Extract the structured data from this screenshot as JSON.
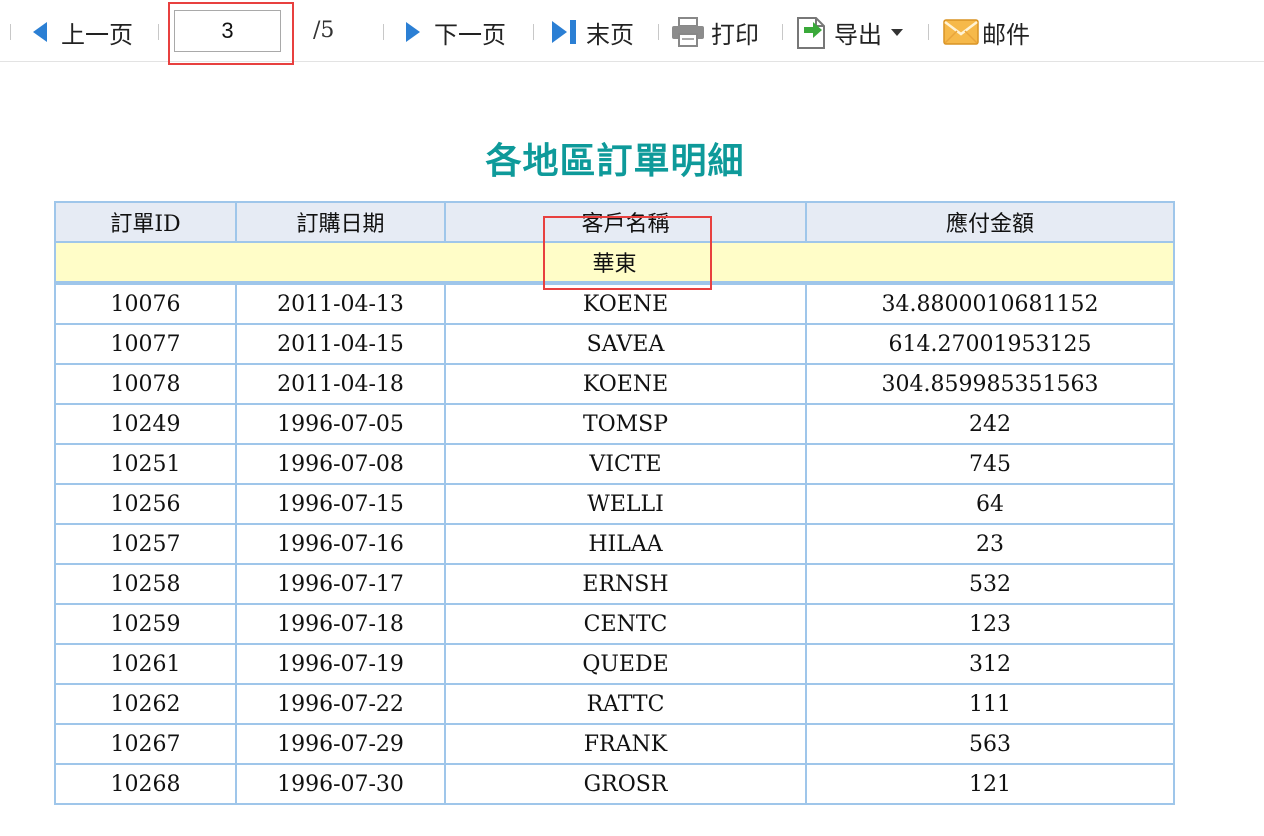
{
  "toolbar": {
    "prev_label": "上一页",
    "current_page": "3",
    "total_pages": "/5",
    "next_label": "下一页",
    "last_label": "末页",
    "print_label": "打印",
    "export_label": "导出",
    "mail_label": "邮件"
  },
  "report": {
    "title": "各地區訂單明細",
    "headers": {
      "order_id": "訂單ID",
      "order_date": "訂購日期",
      "customer": "客戶名稱",
      "amount": "應付金額"
    },
    "group": "華東",
    "rows": [
      {
        "id": "10076",
        "date": "2011-04-13",
        "customer": "KOENE",
        "amount": "34.8800010681152"
      },
      {
        "id": "10077",
        "date": "2011-04-15",
        "customer": "SAVEA",
        "amount": "614.27001953125"
      },
      {
        "id": "10078",
        "date": "2011-04-18",
        "customer": "KOENE",
        "amount": "304.859985351563"
      },
      {
        "id": "10249",
        "date": "1996-07-05",
        "customer": "TOMSP",
        "amount": "242"
      },
      {
        "id": "10251",
        "date": "1996-07-08",
        "customer": "VICTE",
        "amount": "745"
      },
      {
        "id": "10256",
        "date": "1996-07-15",
        "customer": "WELLI",
        "amount": "64"
      },
      {
        "id": "10257",
        "date": "1996-07-16",
        "customer": "HILAA",
        "amount": "23"
      },
      {
        "id": "10258",
        "date": "1996-07-17",
        "customer": "ERNSH",
        "amount": "532"
      },
      {
        "id": "10259",
        "date": "1996-07-18",
        "customer": "CENTC",
        "amount": "123"
      },
      {
        "id": "10261",
        "date": "1996-07-19",
        "customer": "QUEDE",
        "amount": "312"
      },
      {
        "id": "10262",
        "date": "1996-07-22",
        "customer": "RATTC",
        "amount": "111"
      },
      {
        "id": "10267",
        "date": "1996-07-29",
        "customer": "FRANK",
        "amount": "563"
      },
      {
        "id": "10268",
        "date": "1996-07-30",
        "customer": "GROSR",
        "amount": "121"
      }
    ]
  },
  "colors": {
    "title": "#0e9a9a",
    "header_bg": "#e6ebf4",
    "group_bg": "#fffdc8",
    "border": "#9fc6ea",
    "highlight": "#e8403f",
    "icon_blue": "#2b7fd4"
  }
}
